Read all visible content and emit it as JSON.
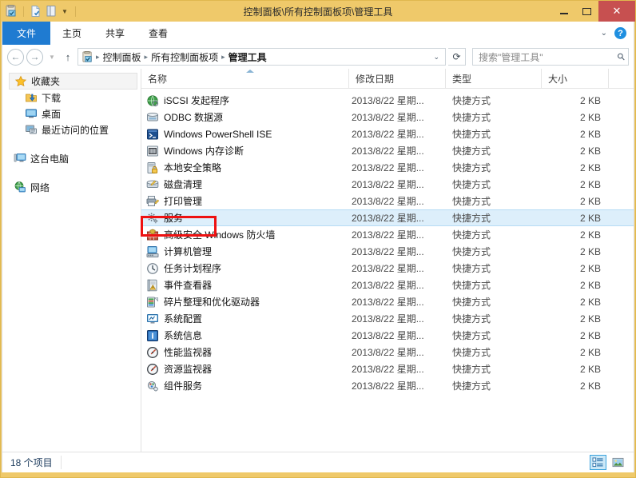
{
  "window": {
    "title": "控制面板\\所有控制面板项\\管理工具",
    "titlebar_color": "#efc96a",
    "close_color": "#c75050",
    "minimize_label": "最小化",
    "maximize_label": "最大化",
    "close_label": "关闭"
  },
  "quick_access": {
    "items": [
      {
        "name": "control-panel-icon",
        "label": "控制面板"
      },
      {
        "name": "new-folder-icon",
        "label": "新建文件夹"
      },
      {
        "name": "properties-icon",
        "label": "属性"
      }
    ],
    "dropdown_label": "自定义快速访问工具栏"
  },
  "ribbon": {
    "tabs": [
      {
        "label": "文件",
        "active": true
      },
      {
        "label": "主页",
        "active": false
      },
      {
        "label": "共享",
        "active": false
      },
      {
        "label": "查看",
        "active": false
      }
    ],
    "collapse_label": "展开功能区",
    "help_label": "?",
    "active_tab_color": "#1f7bd1"
  },
  "address_bar": {
    "back_label": "返回",
    "forward_label": "前进",
    "recent_label": "最近浏览的位置",
    "up_label": "上移到",
    "breadcrumbs": [
      "控制面板",
      "所有控制面板项",
      "管理工具"
    ],
    "separator": "▸",
    "dropdown_label": "上一个位置",
    "refresh_label": "刷新"
  },
  "search": {
    "placeholder": "搜索\"管理工具\"",
    "icon": "search-icon"
  },
  "nav_pane": {
    "groups": [
      {
        "header": {
          "label": "收藏夹",
          "icon": "star-icon",
          "selected": true
        },
        "children": [
          {
            "label": "下载",
            "icon": "downloads-icon"
          },
          {
            "label": "桌面",
            "icon": "desktop-icon"
          },
          {
            "label": "最近访问的位置",
            "icon": "recent-places-icon"
          }
        ]
      },
      {
        "header": {
          "label": "这台电脑",
          "icon": "this-pc-icon",
          "selected": false
        },
        "children": []
      },
      {
        "header": {
          "label": "网络",
          "icon": "network-icon",
          "selected": false
        },
        "children": []
      }
    ]
  },
  "columns": [
    {
      "key": "name",
      "label": "名称",
      "sorted": true,
      "sort_dir": "asc"
    },
    {
      "key": "date",
      "label": "修改日期",
      "sorted": false
    },
    {
      "key": "type",
      "label": "类型",
      "sorted": false
    },
    {
      "key": "size",
      "label": "大小",
      "sorted": false
    }
  ],
  "files": [
    {
      "name": "iSCSI 发起程序",
      "date": "2013/8/22 星期...",
      "type": "快捷方式",
      "size": "2 KB",
      "icon": "globe-icon",
      "selected": false
    },
    {
      "name": "ODBC 数据源",
      "date": "2013/8/22 星期...",
      "type": "快捷方式",
      "size": "2 KB",
      "icon": "odbc-icon",
      "selected": false
    },
    {
      "name": "Windows PowerShell ISE",
      "date": "2013/8/22 星期...",
      "type": "快捷方式",
      "size": "2 KB",
      "icon": "powershell-ise-icon",
      "selected": false
    },
    {
      "name": "Windows 内存诊断",
      "date": "2013/8/22 星期...",
      "type": "快捷方式",
      "size": "2 KB",
      "icon": "memory-diagnostic-icon",
      "selected": false
    },
    {
      "name": "本地安全策略",
      "date": "2013/8/22 星期...",
      "type": "快捷方式",
      "size": "2 KB",
      "icon": "local-security-policy-icon",
      "selected": false
    },
    {
      "name": "磁盘清理",
      "date": "2013/8/22 星期...",
      "type": "快捷方式",
      "size": "2 KB",
      "icon": "disk-cleanup-icon",
      "selected": false
    },
    {
      "name": "打印管理",
      "date": "2013/8/22 星期...",
      "type": "快捷方式",
      "size": "2 KB",
      "icon": "print-management-icon",
      "selected": false
    },
    {
      "name": "服务",
      "date": "2013/8/22 星期...",
      "type": "快捷方式",
      "size": "2 KB",
      "icon": "services-icon",
      "selected": true
    },
    {
      "name": "高级安全 Windows 防火墙",
      "date": "2013/8/22 星期...",
      "type": "快捷方式",
      "size": "2 KB",
      "icon": "firewall-icon",
      "selected": false
    },
    {
      "name": "计算机管理",
      "date": "2013/8/22 星期...",
      "type": "快捷方式",
      "size": "2 KB",
      "icon": "computer-management-icon",
      "selected": false
    },
    {
      "name": "任务计划程序",
      "date": "2013/8/22 星期...",
      "type": "快捷方式",
      "size": "2 KB",
      "icon": "task-scheduler-icon",
      "selected": false
    },
    {
      "name": "事件查看器",
      "date": "2013/8/22 星期...",
      "type": "快捷方式",
      "size": "2 KB",
      "icon": "event-viewer-icon",
      "selected": false
    },
    {
      "name": "碎片整理和优化驱动器",
      "date": "2013/8/22 星期...",
      "type": "快捷方式",
      "size": "2 KB",
      "icon": "defragment-icon",
      "selected": false
    },
    {
      "name": "系统配置",
      "date": "2013/8/22 星期...",
      "type": "快捷方式",
      "size": "2 KB",
      "icon": "system-config-icon",
      "selected": false
    },
    {
      "name": "系统信息",
      "date": "2013/8/22 星期...",
      "type": "快捷方式",
      "size": "2 KB",
      "icon": "system-info-icon",
      "selected": false
    },
    {
      "name": "性能监视器",
      "date": "2013/8/22 星期...",
      "type": "快捷方式",
      "size": "2 KB",
      "icon": "performance-monitor-icon",
      "selected": false
    },
    {
      "name": "资源监视器",
      "date": "2013/8/22 星期...",
      "type": "快捷方式",
      "size": "2 KB",
      "icon": "resource-monitor-icon",
      "selected": false
    },
    {
      "name": "组件服务",
      "date": "2013/8/22 星期...",
      "type": "快捷方式",
      "size": "2 KB",
      "icon": "component-services-icon",
      "selected": false
    }
  ],
  "status_bar": {
    "item_count_text": "18 个项目",
    "views": [
      {
        "name": "details-view-button",
        "label": "详细信息",
        "active": true
      },
      {
        "name": "large-icons-view-button",
        "label": "大图标",
        "active": false
      }
    ]
  },
  "annotation": {
    "color": "#ee1111",
    "target": "服务"
  }
}
